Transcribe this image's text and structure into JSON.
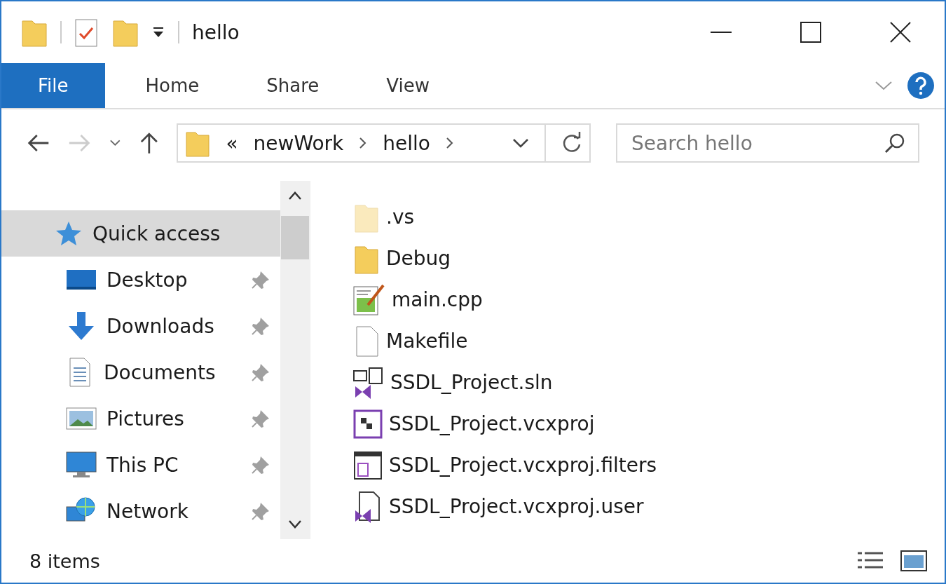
{
  "window": {
    "title": "hello"
  },
  "ribbon_tabs": [
    {
      "label": "File",
      "selected": true
    },
    {
      "label": "Home",
      "selected": false
    },
    {
      "label": "Share",
      "selected": false
    },
    {
      "label": "View",
      "selected": false
    }
  ],
  "address": {
    "overflow": "«",
    "crumbs": [
      "newWork",
      "hello"
    ]
  },
  "search": {
    "placeholder": "Search hello"
  },
  "nav": [
    {
      "label": "Quick access",
      "kind": "star",
      "selected": true,
      "pinned": false
    },
    {
      "label": "Desktop",
      "kind": "desktop",
      "selected": false,
      "pinned": true
    },
    {
      "label": "Downloads",
      "kind": "download",
      "selected": false,
      "pinned": true
    },
    {
      "label": "Documents",
      "kind": "document",
      "selected": false,
      "pinned": true
    },
    {
      "label": "Pictures",
      "kind": "picture",
      "selected": false,
      "pinned": true
    },
    {
      "label": "This PC",
      "kind": "monitor",
      "selected": false,
      "pinned": true
    },
    {
      "label": "Network",
      "kind": "globe",
      "selected": false,
      "pinned": true
    }
  ],
  "files": [
    {
      "name": ".vs",
      "kind": "hidden-folder"
    },
    {
      "name": "Debug",
      "kind": "folder"
    },
    {
      "name": "main.cpp",
      "kind": "source"
    },
    {
      "name": "Makefile",
      "kind": "blank"
    },
    {
      "name": "SSDL_Project.sln",
      "kind": "solution"
    },
    {
      "name": "SSDL_Project.vcxproj",
      "kind": "project"
    },
    {
      "name": "SSDL_Project.vcxproj.filters",
      "kind": "filters"
    },
    {
      "name": "SSDL_Project.vcxproj.user",
      "kind": "user"
    }
  ],
  "status_bar": {
    "count": "8 items"
  }
}
